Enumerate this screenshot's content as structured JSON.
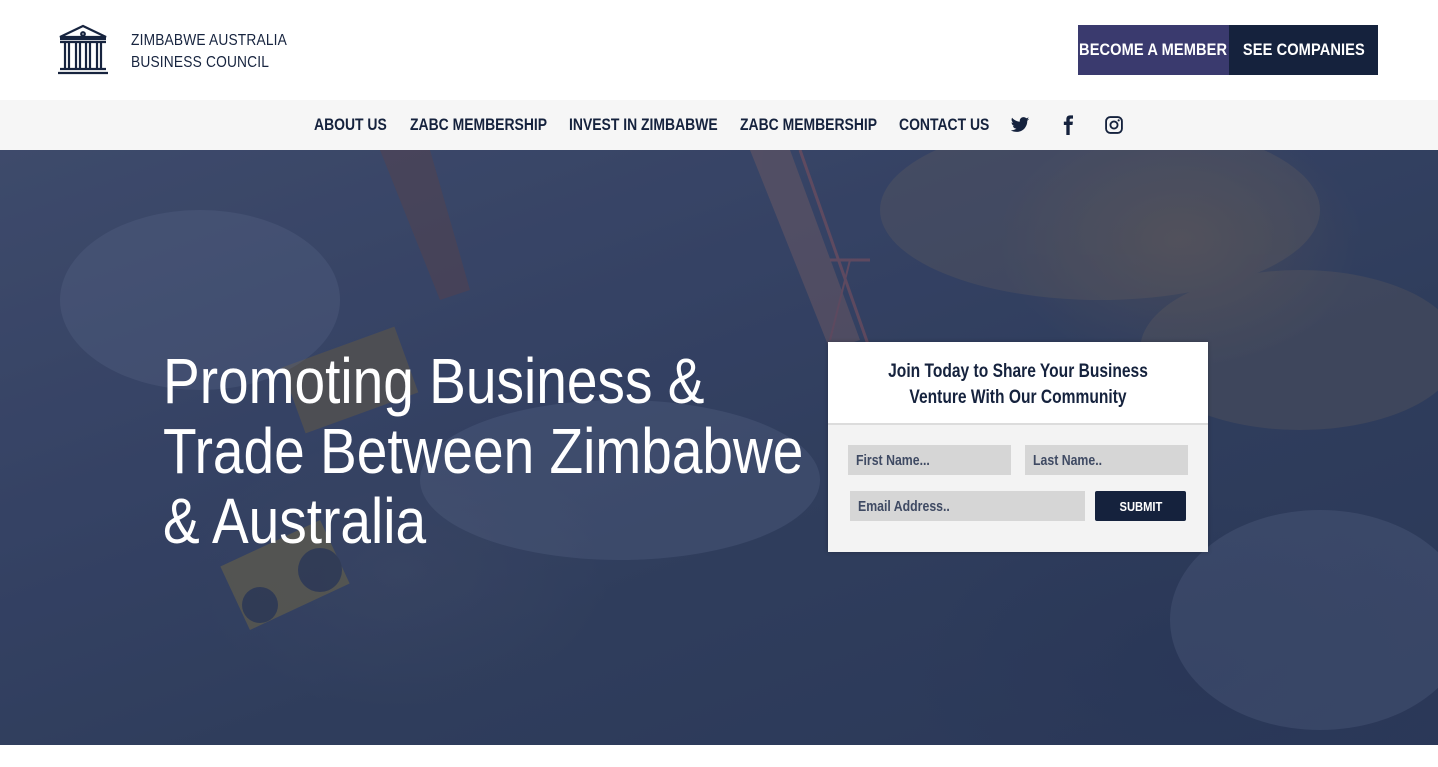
{
  "brand": {
    "line1": "ZIMBABWE AUSTRALIA",
    "line2": "BUSINESS COUNCIL",
    "icon": "building-columns-icon"
  },
  "header": {
    "become_member_label": "BECOME A MEMBER",
    "see_companies_label": "SEE COMPANIES"
  },
  "nav": {
    "items": [
      {
        "label": "ABOUT US"
      },
      {
        "label": "ZABC MEMBERSHIP"
      },
      {
        "label": "INVEST IN ZIMBABWE"
      },
      {
        "label": "ZABC MEMBERSHIP"
      },
      {
        "label": "CONTACT US"
      }
    ],
    "social": [
      "twitter-icon",
      "facebook-icon",
      "instagram-icon"
    ]
  },
  "hero": {
    "title_lines": [
      "Promoting Business &",
      "Trade Between Zimbabwe",
      "& Australia"
    ]
  },
  "signup": {
    "title_line1": "Join Today to Share Your Business",
    "title_line2": "Venture With Our Community",
    "first_name_placeholder": "First Name...",
    "last_name_placeholder": "Last Name..",
    "email_placeholder": "Email Address..",
    "submit_label": "SUBMIT"
  },
  "colors": {
    "navy": "#15223d",
    "purple": "#3a3a6e",
    "nav_bg": "#f6f6f6"
  }
}
